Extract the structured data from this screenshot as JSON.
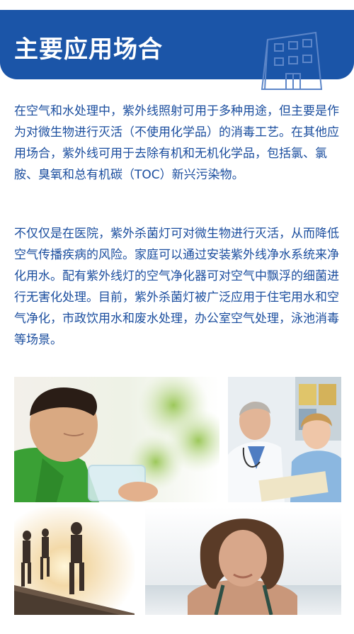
{
  "header": {
    "title": "主要应用场合",
    "icon": "building-icon",
    "background_color": "#1b55a8"
  },
  "body": {
    "text_color": "#1a4d9e",
    "paragraphs": [
      "在空气和水处理中，紫外线照射可用于多种用途，但主要是作为对微生物进行灭活（不使用化学品）的消毒工艺。在其他应用场合，紫外线可用于去除有机和无机化学品，包括氯、氯胺、臭氧和总有机碳（TOC）新兴污染物。",
      "不仅仅是在医院，紫外杀菌灯可对微生物进行灭活，从而降低空气传播疾病的风险。家庭可以通过安装紫外线净水系统来净化用水。配有紫外线灯的空气净化器可对空气中飘浮的细菌进行无害化处理。目前，紫外杀菌灯被广泛应用于住宅用水和空气净化，市政饮用水和废水处理，办公室空气处理，泳池消毒等场景。"
    ]
  },
  "photos": [
    {
      "name": "boy-drinking-water-photo"
    },
    {
      "name": "doctor-and-nurse-photo"
    },
    {
      "name": "runners-on-pier-photo"
    },
    {
      "name": "woman-in-pool-photo"
    }
  ]
}
